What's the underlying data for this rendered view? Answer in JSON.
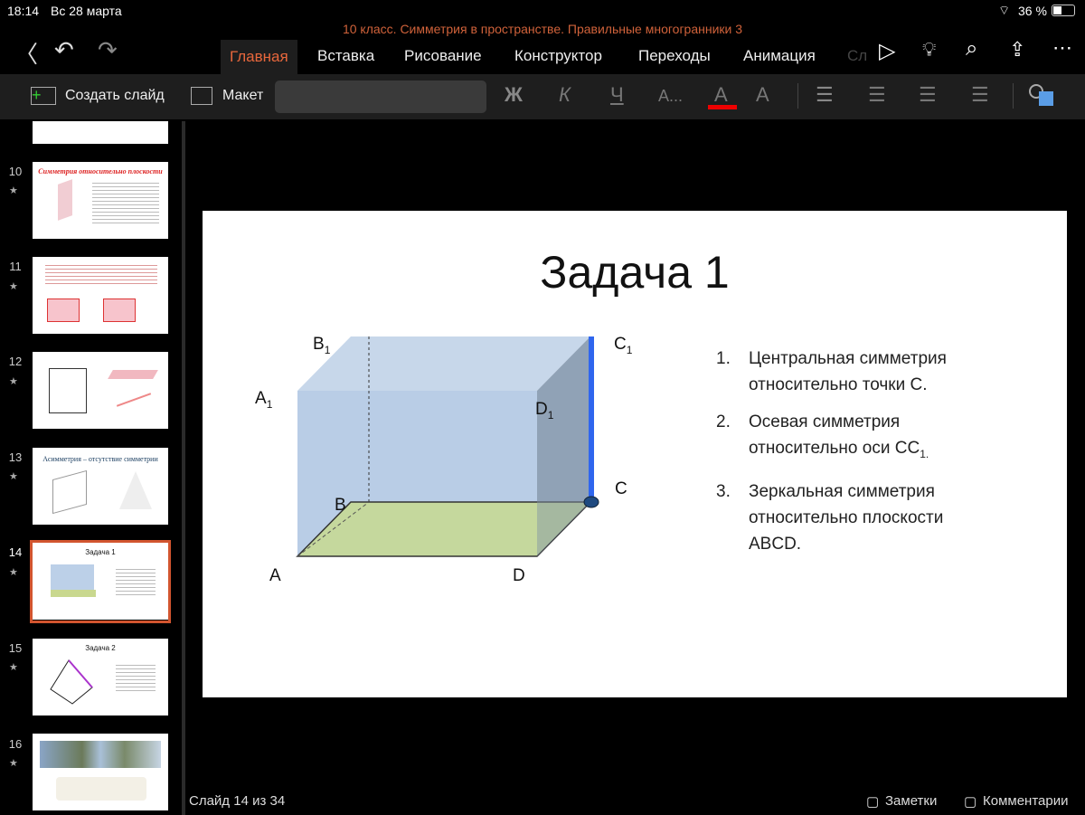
{
  "status": {
    "time": "18:14",
    "date": "Вс 28 марта",
    "battery": "36 %"
  },
  "document_title": "10 класс. Симметрия в пространстве. Правильные многогранники 3",
  "tabs": [
    "Главная",
    "Вставка",
    "Рисование",
    "Конструктор",
    "Переходы",
    "Анимация",
    "Сл"
  ],
  "toolbar": {
    "new_slide": "Создать слайд",
    "layout": "Макет",
    "bold": "Ж",
    "italic": "К",
    "underline": "Ч",
    "font_size": "A...",
    "font_color": "A",
    "highlight": "A"
  },
  "accent": "#e8673c",
  "thumbnails": [
    {
      "num": "10",
      "title": "Симметрия относительно плоскости"
    },
    {
      "num": "11",
      "title": ""
    },
    {
      "num": "12",
      "title": ""
    },
    {
      "num": "13",
      "title": "Асимметрия – отсутствие симметрии"
    },
    {
      "num": "14",
      "title": "Задача 1"
    },
    {
      "num": "15",
      "title": "Задача 2"
    },
    {
      "num": "16",
      "title": ""
    }
  ],
  "slide": {
    "title": "Задача 1",
    "labels": {
      "A": "A",
      "B": "B",
      "C": "C",
      "D": "D",
      "A1": "A",
      "B1": "B",
      "C1": "C",
      "D1": "D",
      "sub": "1"
    },
    "items": [
      {
        "n": "1.",
        "line1": "Центральная симметрия",
        "line2": "относительно точки С."
      },
      {
        "n": "2.",
        "line1": "Осевая симметрия",
        "line2": "относительно оси СС",
        "sub": "1."
      },
      {
        "n": "3.",
        "line1": "Зеркальная симметрия",
        "line2": "относительно плоскости",
        "line3": "ABCD."
      }
    ]
  },
  "footer": {
    "slide_counter": "Слайд 14 из 34",
    "notes": "Заметки",
    "comments": "Комментарии"
  }
}
